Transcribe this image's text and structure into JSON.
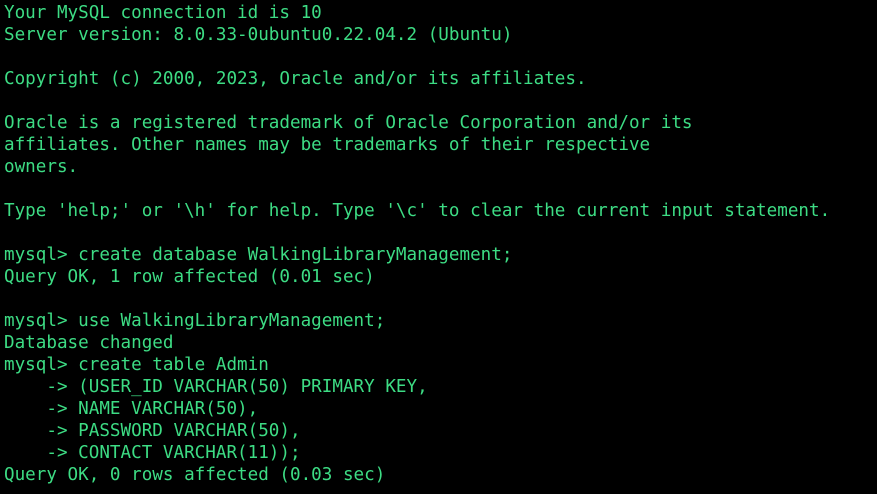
{
  "colors": {
    "background": "#000000",
    "text": "#3ddc84"
  },
  "lines": [
    "Your MySQL connection id is 10",
    "Server version: 8.0.33-0ubuntu0.22.04.2 (Ubuntu)",
    "",
    "Copyright (c) 2000, 2023, Oracle and/or its affiliates.",
    "",
    "Oracle is a registered trademark of Oracle Corporation and/or its",
    "affiliates. Other names may be trademarks of their respective",
    "owners.",
    "",
    "Type 'help;' or '\\h' for help. Type '\\c' to clear the current input statement.",
    "",
    "mysql> create database WalkingLibraryManagement;",
    "Query OK, 1 row affected (0.01 sec)",
    "",
    "mysql> use WalkingLibraryManagement;",
    "Database changed",
    "mysql> create table Admin",
    "    -> (USER_ID VARCHAR(50) PRIMARY KEY,",
    "    -> NAME VARCHAR(50),",
    "    -> PASSWORD VARCHAR(50),",
    "    -> CONTACT VARCHAR(11));",
    "Query OK, 0 rows affected (0.03 sec)"
  ]
}
